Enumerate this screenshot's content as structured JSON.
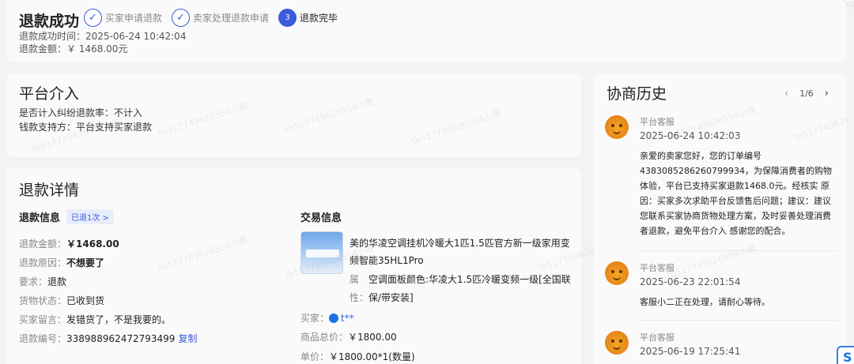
{
  "status": {
    "title": "退款成功",
    "steps": [
      {
        "label": "买家申请退款",
        "icon": "check-icon",
        "mark": "✓"
      },
      {
        "label": "卖家处理退款申请",
        "icon": "check-icon",
        "mark": "✓"
      },
      {
        "label": "退款完毕",
        "icon": "step-number-icon",
        "mark": "3"
      }
    ],
    "time_line": "退款成功时间：2025-06-24 10:42:04",
    "amount_line": "退款金额：￥ 1468.00元"
  },
  "platform": {
    "title": "平台介入",
    "dispute_rate": "是否计入纠纷退款率：不计入",
    "funding": "钱款支持方：平台支持买家退款"
  },
  "refund_detail": {
    "title": "退款详情",
    "info_title": "退款信息",
    "badge": "已退1次 >",
    "rows": {
      "amount_label": "退款金额：",
      "amount_value": "￥1468.00",
      "reason_label": "退款原因：",
      "reason_value": "不想要了",
      "request_label": "要求：",
      "request_value": "退款",
      "goods_label": "货物状态：",
      "goods_value": "已收到货",
      "message_label": "买家留言：",
      "message_value": "发错货了，不是我要的。",
      "number_label": "退款编号：",
      "number_value": "338988962472793499",
      "copy_label": "复制"
    },
    "trade_title": "交易信息",
    "product_title": "美的华凌空调挂机冷暖大1匹1.5匹官方新一级家用变频智能35HL1Pro",
    "attr_key": "属性：",
    "attr_value": "空调面板颜色:华凌大1.5匹冷暖变频一级[全国联保/带安装]",
    "buyer_label": "买家：",
    "buyer_name": "t**",
    "total_label": "商品总价：",
    "total_value": "￥1800.00",
    "unit_label": "单价：",
    "unit_value": "￥1800.00*1(数量)"
  },
  "history": {
    "title": "协商历史",
    "page": "1/6",
    "prev": "‹",
    "next": "›",
    "messages": [
      {
        "name": "平台客服",
        "time": "2025-06-24 10:42:03",
        "text": "亲爱的卖家您好，您的订单编号4383085286260799934，为保障消费者的购物体验，平台已支持买家退款1468.0元。经核实 原因：买家多次求助平台反馈售后问题；建议：建议您联系买家协商货物处理方案，及时妥善处理消费者退款，避免平台介入  感谢您的配合。"
      },
      {
        "name": "平台客服",
        "time": "2025-06-23 22:01:54",
        "text": "客服小二正在处理，请耐心等待。"
      },
      {
        "name": "平台客服",
        "time": "2025-06-19 17:25:41",
        "text": ""
      }
    ]
  },
  "widget": {
    "glyph": "S"
  },
  "watermark": "tb5177496265​54小鹿"
}
